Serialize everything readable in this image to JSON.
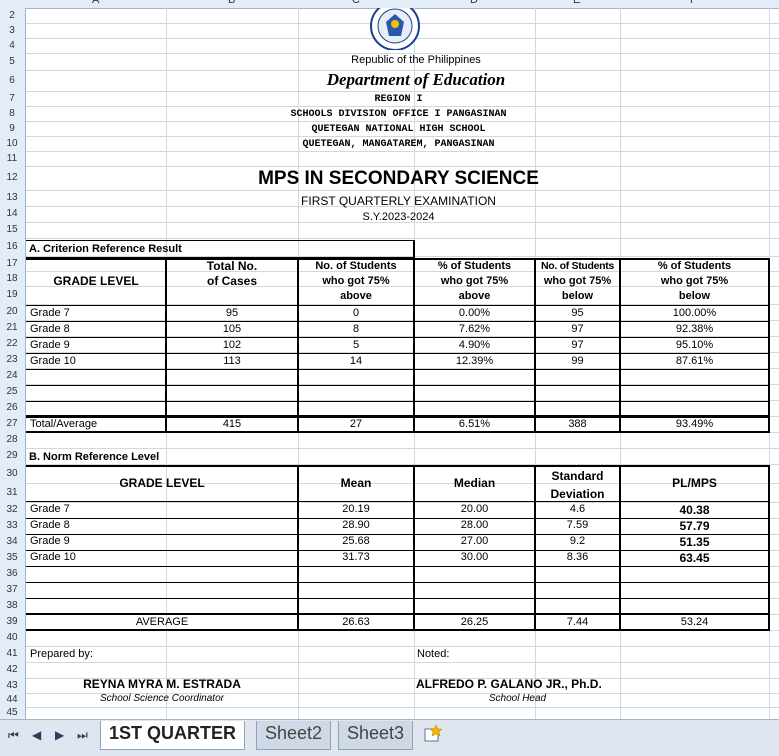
{
  "columns": [
    "A",
    "B",
    "C",
    "D",
    "E",
    "F"
  ],
  "rows": [
    "2",
    "3",
    "4",
    "5",
    "6",
    "7",
    "8",
    "9",
    "10",
    "11",
    "12",
    "13",
    "14",
    "15",
    "16",
    "17",
    "18",
    "19",
    "20",
    "21",
    "22",
    "23",
    "24",
    "25",
    "26",
    "27",
    "28",
    "29",
    "30",
    "31",
    "32",
    "33",
    "34",
    "35",
    "36",
    "37",
    "38",
    "39",
    "40",
    "41",
    "42",
    "43",
    "44",
    "45"
  ],
  "header": {
    "republic": "Republic of the Philippines",
    "department": "Department of Education",
    "region": "REGION I",
    "division": "SCHOOLS DIVISION OFFICE I PANGASINAN",
    "school": "QUETEGAN NATIONAL HIGH SCHOOL",
    "address": "QUETEGAN, MANGATAREM, PANGASINAN",
    "title": "MPS IN SECONDARY SCIENCE",
    "exam": "FIRST QUARTERLY EXAMINATION",
    "sy": "S.Y.2023-2024"
  },
  "sectionA": {
    "title": "A. Criterion Reference Result",
    "h_grade": "GRADE LEVEL",
    "h_total": [
      "Total No.",
      "of Cases"
    ],
    "h_no_above": [
      "No. of Students",
      "who got 75%",
      "above"
    ],
    "h_pct_above": [
      "% of Students",
      "who got 75%",
      "above"
    ],
    "h_no_below": [
      "No. of Students",
      "who got 75%",
      "below"
    ],
    "h_pct_below": [
      "% of Students",
      "who got 75%",
      "below"
    ],
    "rows": [
      {
        "grade": "Grade 7",
        "total": "95",
        "above": "0",
        "pct_above": "0.00%",
        "below": "95",
        "pct_below": "100.00%"
      },
      {
        "grade": "Grade 8",
        "total": "105",
        "above": "8",
        "pct_above": "7.62%",
        "below": "97",
        "pct_below": "92.38%"
      },
      {
        "grade": "Grade 9",
        "total": "102",
        "above": "5",
        "pct_above": "4.90%",
        "below": "97",
        "pct_below": "95.10%"
      },
      {
        "grade": "Grade 10",
        "total": "113",
        "above": "14",
        "pct_above": "12.39%",
        "below": "99",
        "pct_below": "87.61%"
      }
    ],
    "total": {
      "grade": "Total/Average",
      "total": "415",
      "above": "27",
      "pct_above": "6.51%",
      "below": "388",
      "pct_below": "93.49%"
    }
  },
  "sectionB": {
    "title": "B. Norm Reference Level",
    "h_grade": "GRADE LEVEL",
    "h_mean": "Mean",
    "h_median": "Median",
    "h_sd": [
      "Standard",
      "Deviation"
    ],
    "h_plmps": "PL/MPS",
    "rows": [
      {
        "grade": "Grade 7",
        "mean": "20.19",
        "median": "20.00",
        "sd": "4.6",
        "plmps": "40.38"
      },
      {
        "grade": "Grade 8",
        "mean": "28.90",
        "median": "28.00",
        "sd": "7.59",
        "plmps": "57.79"
      },
      {
        "grade": "Grade 9",
        "mean": "25.68",
        "median": "27.00",
        "sd": "9.2",
        "plmps": "51.35"
      },
      {
        "grade": "Grade 10",
        "mean": "31.73",
        "median": "30.00",
        "sd": "8.36",
        "plmps": "63.45"
      }
    ],
    "average": {
      "label": "AVERAGE",
      "mean": "26.63",
      "median": "26.25",
      "sd": "7.44",
      "plmps": "53.24"
    }
  },
  "signatures": {
    "prepared_label": "Prepared by:",
    "noted_label": "Noted:",
    "preparer_name": "REYNA MYRA M. ESTRADA",
    "preparer_role": "School Science Coordinator",
    "head_name": "ALFREDO P. GALANO JR., Ph.D.",
    "head_role": "School Head"
  },
  "tabs": [
    {
      "label": "1ST QUARTER",
      "active": true
    },
    {
      "label": "Sheet2",
      "active": false
    },
    {
      "label": "Sheet3",
      "active": false
    }
  ],
  "nav": {
    "first": "⏮",
    "prev": "◀",
    "next": "▶",
    "last": "⏭"
  },
  "colors": {
    "header_bg": "#e4ecf7",
    "grid": "#d0d7e5",
    "tabbar_bg": "#dfe6ef"
  }
}
